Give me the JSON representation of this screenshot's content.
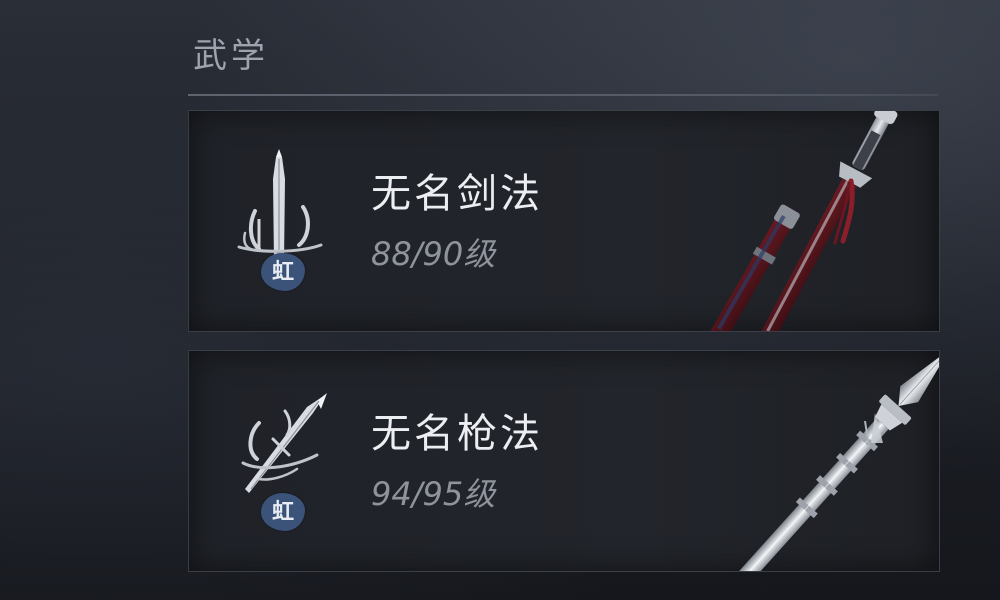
{
  "section": {
    "title": "武学"
  },
  "skills": [
    {
      "name": "无名剑法",
      "level": "88/90级",
      "badge": "虹",
      "icon": "sword-skill-icon",
      "weapon": "sword-art"
    },
    {
      "name": "无名枪法",
      "level": "94/95级",
      "badge": "虹",
      "icon": "spear-skill-icon",
      "weapon": "spear-art"
    }
  ],
  "colors": {
    "badge": "#3b5379",
    "name": "#eceef1",
    "level": "#8e939c",
    "tassel": "#8a1f2a"
  }
}
